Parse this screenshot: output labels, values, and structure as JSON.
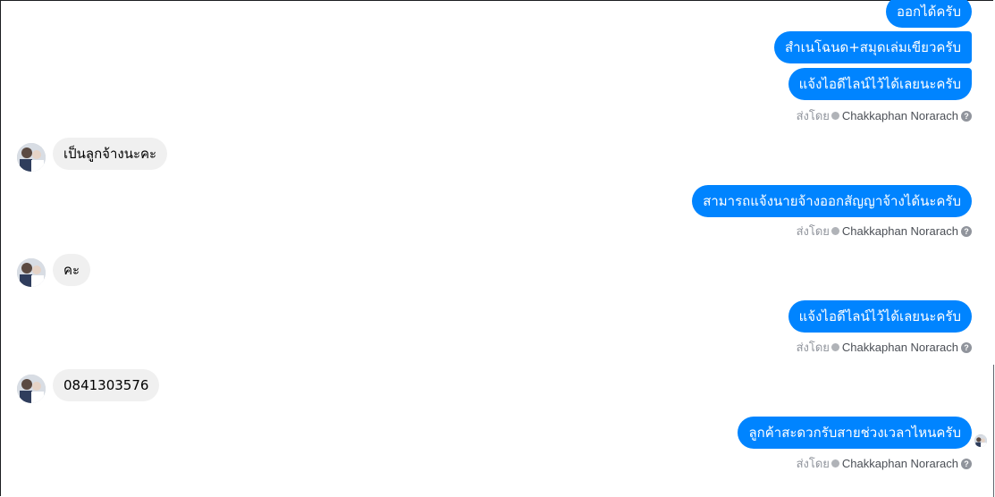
{
  "messages": {
    "m1": "ออกได้ครับ",
    "m2": "สำเนโฉนด+สมุดเล่มเขียวครับ",
    "m3": "แจ้งไอดีไลน์ไว้ได้เลยนะครับ",
    "m4": "เป็นลูกจ้างนะคะ",
    "m5": "สามารถแจ้งนายจ้างออกสัญญาจ้างได้นะครับ",
    "m6": "คะ",
    "m7": "แจ้งไอดีไลน์ไว้ได้เลยนะครับ",
    "m8": "0841303576",
    "m9": "ลูกค้าสะดวกรับสายช่วงเวลาไหนครับ"
  },
  "sent_by": {
    "prefix": "ส่งโดย",
    "name": "Chakkaphan Norarach",
    "help": "?"
  },
  "colors": {
    "outgoing_bubble": "#0084ff",
    "incoming_bubble": "#f0f0f0",
    "meta_text": "#90949c"
  }
}
